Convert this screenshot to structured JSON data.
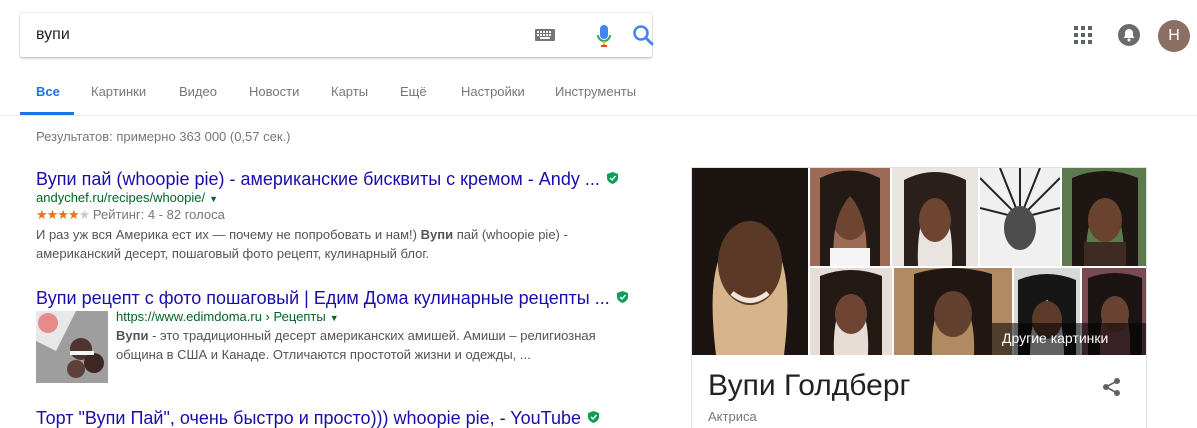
{
  "search": {
    "query": "вупи"
  },
  "account": {
    "avatar_letter": "Н"
  },
  "tabs": [
    "Все",
    "Картинки",
    "Видео",
    "Новости",
    "Карты",
    "Ещё",
    "Настройки",
    "Инструменты"
  ],
  "stats": "Результатов: примерно 363 000 (0,57 сек.)",
  "results": [
    {
      "title": "Вупи пай (whoopie pie) - американские бисквиты с кремом - Andy ...",
      "url": "andychef.ru/recipes/whoopie/",
      "rating_stars": 4,
      "rating_text": "Рейтинг: 4 - 82 голоса",
      "snippet_line1_pre": "И раз уж вся Америка ест их — почему не попробовать и нам!) ",
      "snippet_line1_bold": "Вупи",
      "snippet_line1_post": " пай (whoopie pie) -",
      "snippet_line2": "американский десерт, пошаговый фото рецепт, кулинарный блог."
    },
    {
      "title": "Вупи рецепт с фото пошаговый | Едим Дома кулинарные рецепты ...",
      "url": "https://www.edimdoma.ru › Рецепты",
      "snippet_bold": "Вупи",
      "snippet_line1": " - это традиционный десерт американских амишей. Амиши – религиозная",
      "snippet_line2": "община в США и Канаде. Отличаются простотой жизни и одежды, ..."
    },
    {
      "title": "Торт \"Вупи Пай\", очень быстро и просто))) whoopie pie, - YouTube"
    }
  ],
  "knowledge_panel": {
    "more_images": "Другие картинки",
    "title": "Вупи Голдберг",
    "subtitle": "Актриса"
  },
  "colors": {
    "link": "#1a0dab",
    "url": "#006621",
    "accent": "#1a73e8",
    "stars": "#e7711b"
  }
}
